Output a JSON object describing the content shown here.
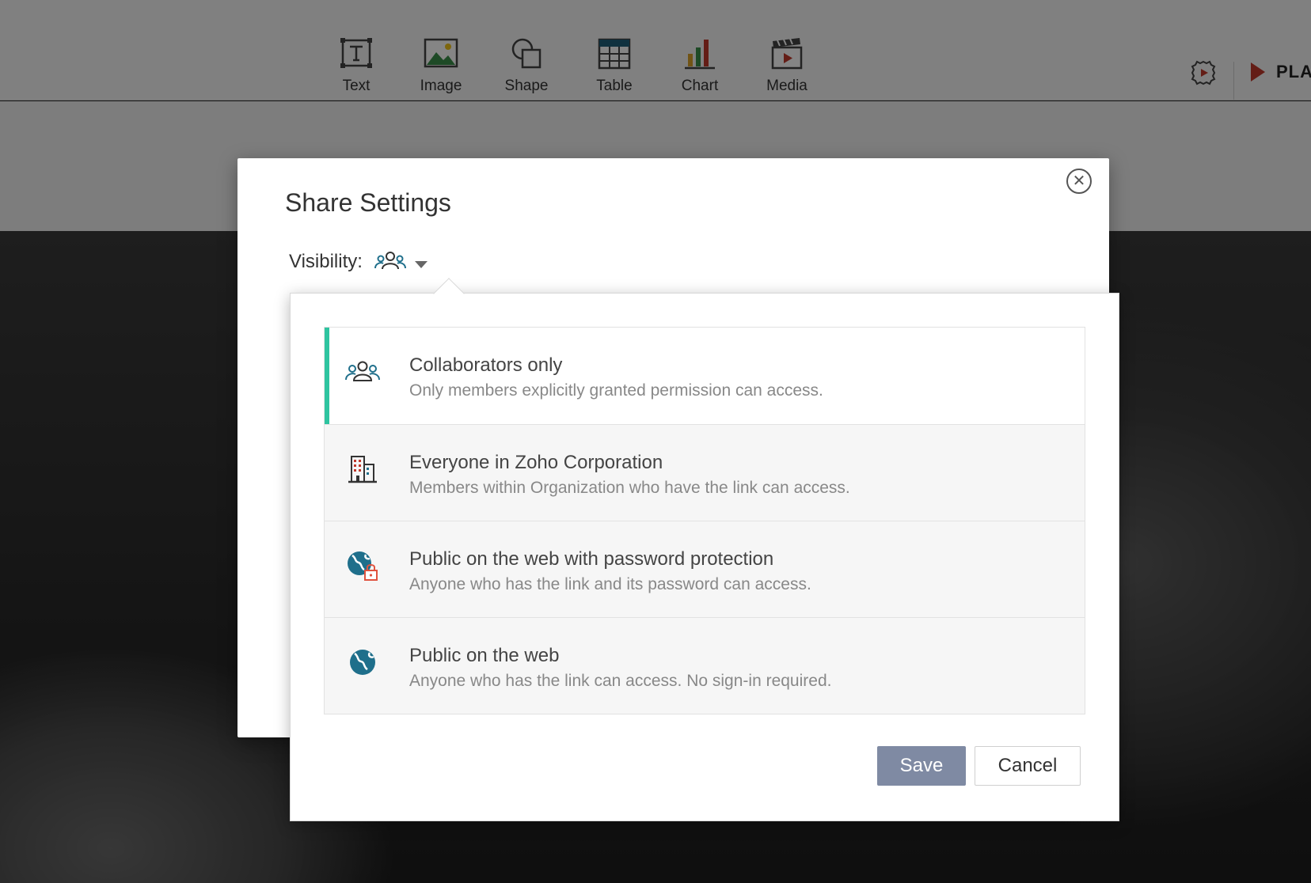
{
  "toolbar": {
    "items": [
      {
        "label": "Text",
        "icon": "text-icon"
      },
      {
        "label": "Image",
        "icon": "image-icon"
      },
      {
        "label": "Shape",
        "icon": "shape-icon"
      },
      {
        "label": "Table",
        "icon": "table-icon"
      },
      {
        "label": "Chart",
        "icon": "chart-icon"
      },
      {
        "label": "Media",
        "icon": "media-icon"
      }
    ],
    "play_label": "PLA"
  },
  "dialog": {
    "title": "Share Settings",
    "close_glyph": "✕",
    "visibility_label": "Visibility:",
    "selected_visibility_icon": "collaborators-icon"
  },
  "visibility_options": [
    {
      "title": "Collaborators only",
      "description": "Only members explicitly granted permission can access.",
      "icon": "collaborators-icon",
      "selected": true
    },
    {
      "title": "Everyone in Zoho Corporation",
      "description": "Members within Organization who have the link can access.",
      "icon": "organization-building-icon",
      "selected": false
    },
    {
      "title": "Public on the web with password protection",
      "description": "Anyone who has the link and its password can access.",
      "icon": "globe-lock-icon",
      "selected": false
    },
    {
      "title": "Public on the web",
      "description": "Anyone who has the link can access. No sign-in required.",
      "icon": "globe-icon",
      "selected": false
    }
  ],
  "buttons": {
    "save": "Save",
    "cancel": "Cancel"
  },
  "colors": {
    "selected_accent": "#2ec4a0",
    "save_button": "#7f8aa3",
    "play_accent": "#c0392b",
    "icon_teal": "#1f6f8b"
  }
}
